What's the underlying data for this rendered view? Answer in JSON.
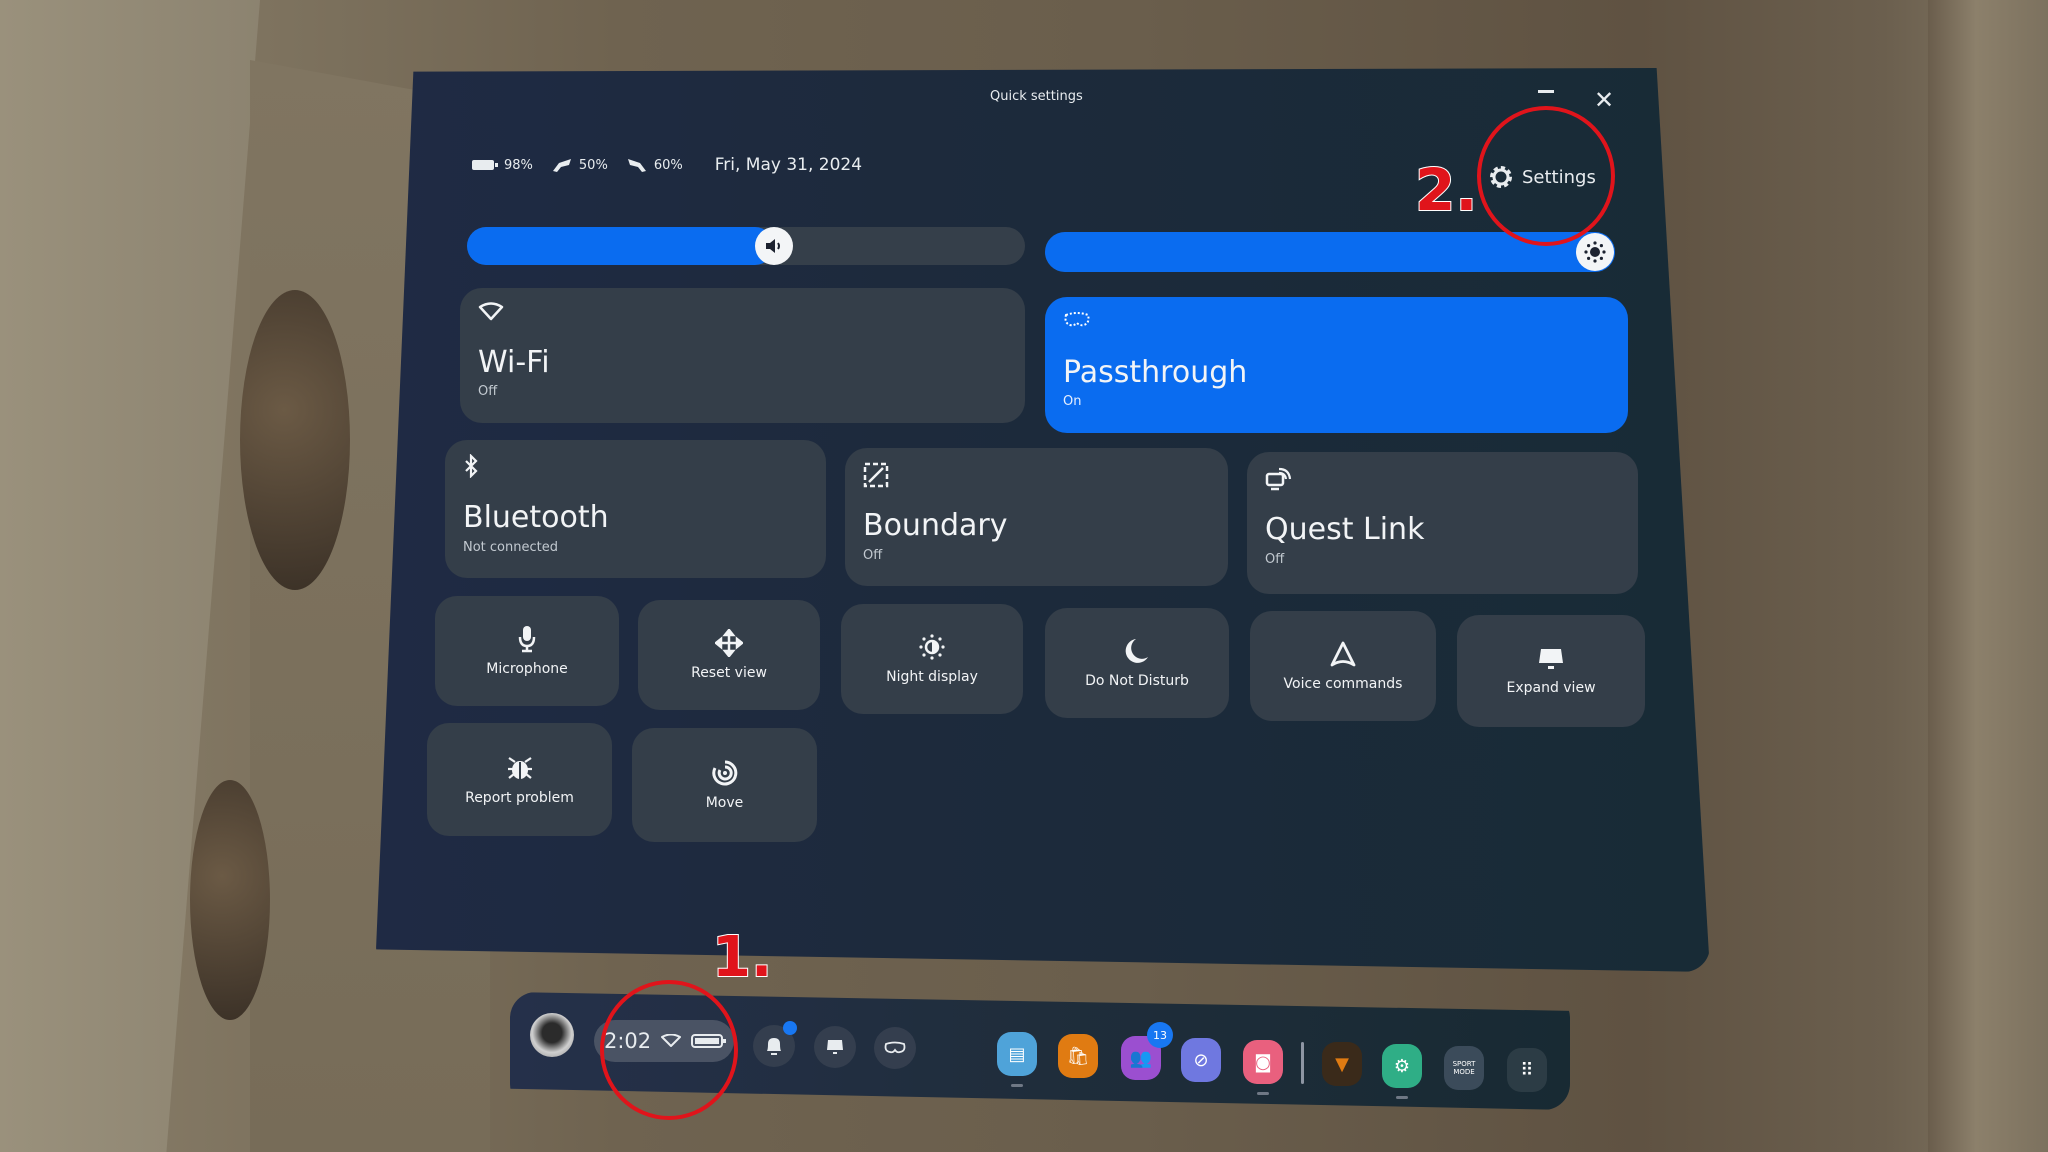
{
  "window": {
    "title": "Quick settings",
    "minimize_icon": "minimize-icon",
    "close_icon": "close-icon"
  },
  "status": {
    "headset_battery": "98%",
    "left_controller_battery": "50%",
    "right_controller_battery": "60%",
    "date": "Fri, May 31, 2024"
  },
  "settings_button": {
    "label": "Settings",
    "icon": "gear-icon"
  },
  "sliders": {
    "volume": {
      "icon": "speaker-icon",
      "value_percent": 55
    },
    "brightness": {
      "icon": "sun-icon",
      "value_percent": 100
    }
  },
  "large_tiles": [
    {
      "id": "wifi",
      "label": "Wi-Fi",
      "status": "Off",
      "icon": "wifi-icon",
      "active": false
    },
    {
      "id": "passthrough",
      "label": "Passthrough",
      "status": "On",
      "icon": "passthrough-icon",
      "active": true
    },
    {
      "id": "bluetooth",
      "label": "Bluetooth",
      "status": "Not connected",
      "icon": "bluetooth-icon",
      "active": false
    },
    {
      "id": "boundary",
      "label": "Boundary",
      "status": "Off",
      "icon": "boundary-icon",
      "active": false
    },
    {
      "id": "quest-link",
      "label": "Quest Link",
      "status": "Off",
      "icon": "quest-link-icon",
      "active": false
    }
  ],
  "small_tiles": [
    {
      "id": "microphone",
      "label": "Microphone",
      "icon": "microphone-icon"
    },
    {
      "id": "reset-view",
      "label": "Reset view",
      "icon": "move-arrows-icon"
    },
    {
      "id": "night-display",
      "label": "Night display",
      "icon": "night-display-icon"
    },
    {
      "id": "do-not-disturb",
      "label": "Do Not Disturb",
      "icon": "moon-icon"
    },
    {
      "id": "voice-commands",
      "label": "Voice commands",
      "icon": "voice-commands-icon"
    },
    {
      "id": "expand-view",
      "label": "Expand view",
      "icon": "expand-view-icon"
    },
    {
      "id": "report-problem",
      "label": "Report problem",
      "icon": "bug-icon"
    },
    {
      "id": "move",
      "label": "Move",
      "icon": "move-icon"
    }
  ],
  "taskbar": {
    "time": "2:02",
    "apps": [
      {
        "id": "app-library",
        "icon": "library-icon",
        "color": "#4fa3d9"
      },
      {
        "id": "store",
        "icon": "store-icon",
        "color": "#e07b12"
      },
      {
        "id": "people",
        "icon": "people-icon",
        "color": "#9b4fd0",
        "badge": "13"
      },
      {
        "id": "explore",
        "icon": "explore-icon",
        "color": "#6f78e0"
      },
      {
        "id": "camera",
        "icon": "camera-icon",
        "color": "#e9607e"
      },
      {
        "id": "game-triangle",
        "icon": "game-icon",
        "color": "#3a2a1a"
      },
      {
        "id": "settings-app",
        "icon": "gear-app-icon",
        "color": "#2fae86"
      },
      {
        "id": "sport-mode",
        "icon": "sport-mode-icon",
        "color": "#3b4b5a",
        "text": "SPORT MODE"
      },
      {
        "id": "all-apps",
        "icon": "app-grid-icon",
        "color": "#2c3c45"
      }
    ]
  },
  "annotations": [
    {
      "number": "1.",
      "target": "clock-pill",
      "color": "#e0141b"
    },
    {
      "number": "2.",
      "target": "settings-button",
      "color": "#e0141b"
    }
  ]
}
